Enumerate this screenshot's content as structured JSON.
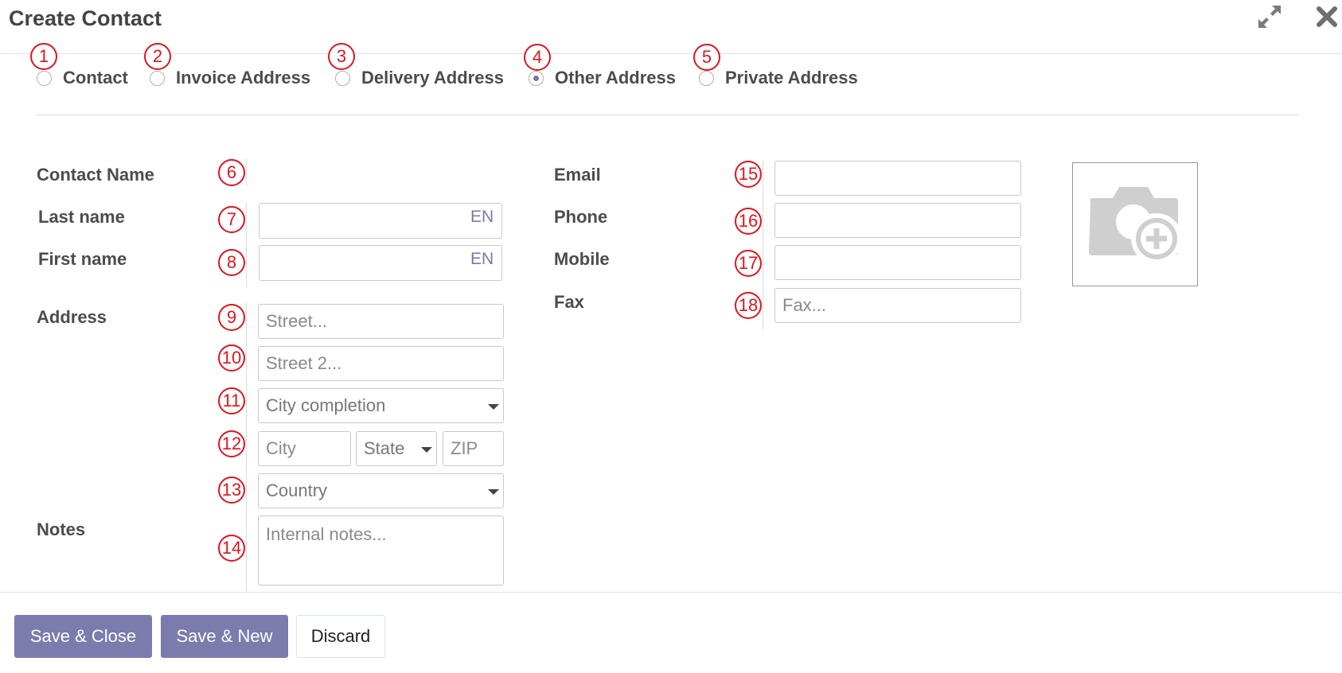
{
  "dialog": {
    "title": "Create Contact"
  },
  "header_icons": {
    "expand": "expand-icon",
    "close": "close-icon"
  },
  "address_types": [
    {
      "label": "Contact",
      "selected": false
    },
    {
      "label": "Invoice Address",
      "selected": false
    },
    {
      "label": "Delivery Address",
      "selected": false
    },
    {
      "label": "Other Address",
      "selected": true
    },
    {
      "label": "Private Address",
      "selected": false
    }
  ],
  "labels": {
    "contact_name": "Contact Name",
    "last_name": "Last name",
    "first_name": "First name",
    "address": "Address",
    "notes": "Notes",
    "email": "Email",
    "phone": "Phone",
    "mobile": "Mobile",
    "fax": "Fax"
  },
  "fields": {
    "last_name": {
      "value": "",
      "lang": "EN"
    },
    "first_name": {
      "value": "",
      "lang": "EN"
    },
    "street": {
      "placeholder": "Street..."
    },
    "street2": {
      "placeholder": "Street 2..."
    },
    "city_completion": {
      "placeholder": "City completion"
    },
    "city": {
      "placeholder": "City"
    },
    "state": {
      "placeholder": "State"
    },
    "zip": {
      "placeholder": "ZIP"
    },
    "country": {
      "placeholder": "Country"
    },
    "notes": {
      "placeholder": "Internal notes..."
    },
    "email": {
      "value": ""
    },
    "phone": {
      "value": ""
    },
    "mobile": {
      "value": ""
    },
    "fax": {
      "placeholder": "Fax..."
    }
  },
  "avatar": {
    "icon": "camera-plus-icon"
  },
  "buttons": {
    "save_close": "Save & Close",
    "save_new": "Save & New",
    "discard": "Discard"
  },
  "annotations": [
    "1",
    "2",
    "3",
    "4",
    "5",
    "6",
    "7",
    "8",
    "9",
    "10",
    "11",
    "12",
    "13",
    "14",
    "15",
    "16",
    "17",
    "18"
  ],
  "colors": {
    "primary": "#7c7bad",
    "annotation": "#e0141e",
    "radio_checked": "#7a77a8"
  }
}
